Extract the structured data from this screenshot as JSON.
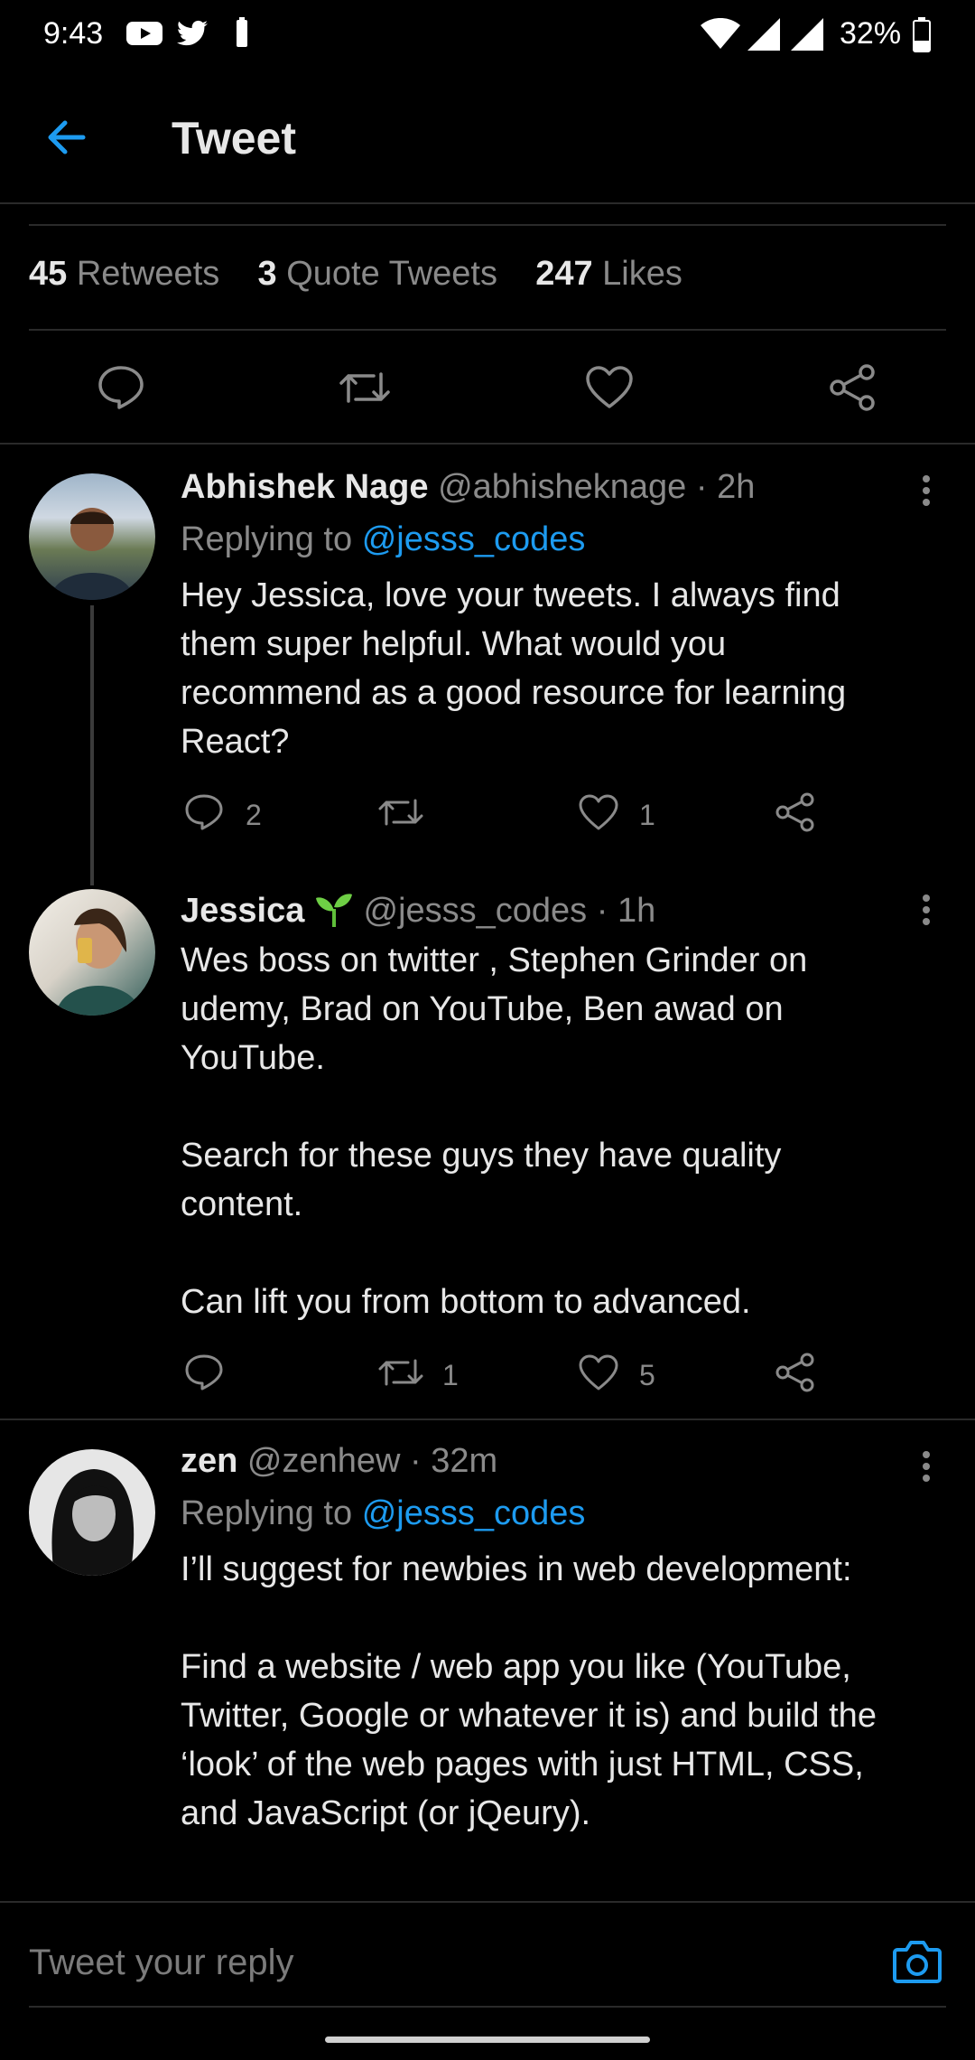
{
  "status_bar": {
    "time": "9:43",
    "battery": "32%"
  },
  "header": {
    "title": "Tweet"
  },
  "stats": {
    "retweets_count": "45",
    "retweets_label": "Retweets",
    "quotes_count": "3",
    "quotes_label": "Quote Tweets",
    "likes_count": "247",
    "likes_label": "Likes"
  },
  "replies": [
    {
      "name": "Abhishek Nage",
      "handle": "@abhisheknage",
      "time": "· 2h",
      "replying_prefix": "Replying to",
      "replying_handle": "@jesss_codes",
      "text": "Hey Jessica, love your tweets. I always find\nthem super helpful. What would you\nrecommend as a good resource for learning\nReact?",
      "reply_count": "2",
      "retweet_count": "",
      "like_count": "1"
    },
    {
      "name": "Jessica",
      "handle": "@jesss_codes",
      "time": "· 1h",
      "text": "Wes boss on twitter , Stephen Grinder on\nudemy, Brad on YouTube, Ben awad on\nYouTube.\n\nSearch for these guys they have quality\ncontent.\n\nCan lift you from bottom to advanced.",
      "reply_count": "",
      "retweet_count": "1",
      "like_count": "5"
    },
    {
      "name": "zen",
      "handle": "@zenhew",
      "time": "· 32m",
      "replying_prefix": "Replying to",
      "replying_handle": "@jesss_codes",
      "text": "I’ll suggest for newbies in web development:\n\nFind a website / web app you like (YouTube,\nTwitter, Google or whatever it is) and build the\n‘look’ of the web pages with just HTML, CSS,\nand JavaScript (or jQeury)."
    }
  ],
  "composer": {
    "placeholder": "Tweet your reply"
  },
  "colors": {
    "accent": "#1d9bf0",
    "background": "#000000",
    "muted": "#8a8a8a"
  }
}
